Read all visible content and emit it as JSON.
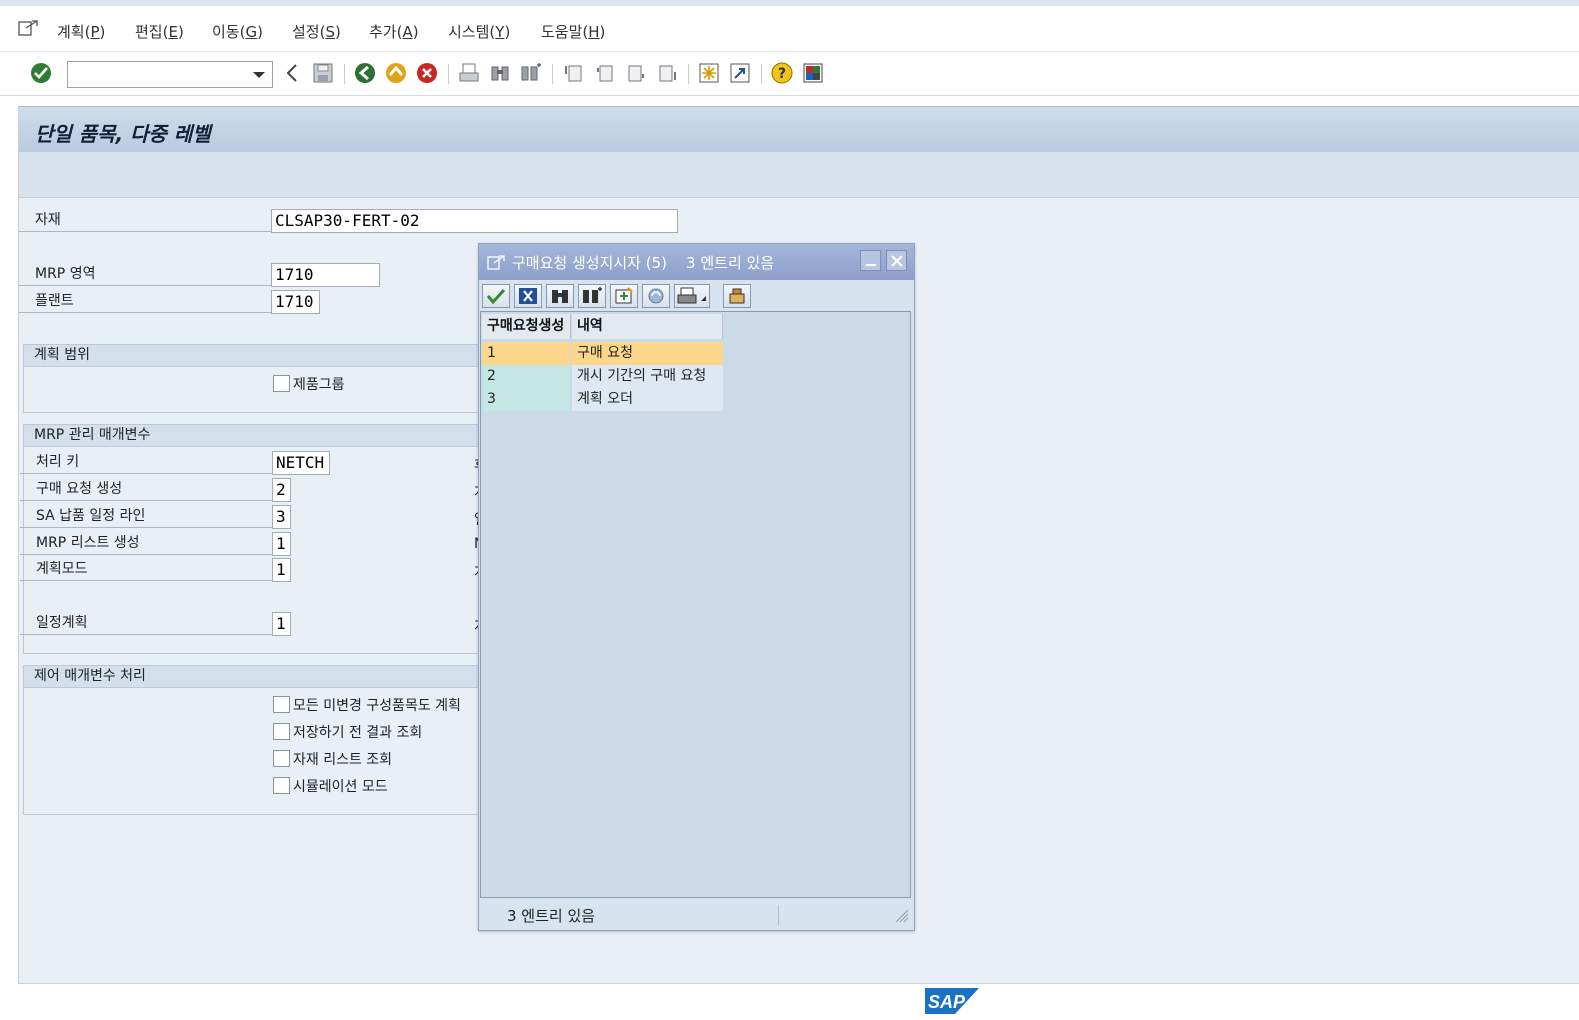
{
  "menubar": {
    "items": [
      {
        "text": "계획(",
        "key": "P",
        "end": ")"
      },
      {
        "text": "편집(",
        "key": "E",
        "end": ")"
      },
      {
        "text": "이동(",
        "key": "G",
        "end": ")"
      },
      {
        "text": "설정(",
        "key": "S",
        "end": ")"
      },
      {
        "text": "추가(",
        "key": "A",
        "end": ")"
      },
      {
        "text": "시스템(",
        "key": "Y",
        "end": ")"
      },
      {
        "text": "도움말(",
        "key": "H",
        "end": ")"
      }
    ]
  },
  "toolbar": {
    "command_field_value": ""
  },
  "screen": {
    "title": "단일 품목, 다중 레벨"
  },
  "fields": {
    "material_label": "자재",
    "material_value": "CLSAP30-FERT-02",
    "mrp_area_label": "MRP 영역",
    "mrp_area_value": "1710",
    "plant_label": "플랜트",
    "plant_value": "1710"
  },
  "groups": {
    "planning_scope": {
      "title": "계획 범위",
      "product_group_label": "제품그룹"
    },
    "mrp_control": {
      "title": "MRP 관리 매개변수",
      "processing_key_label": "처리 키",
      "processing_key_value": "NETCH",
      "create_pur_req_label": "구매 요청 생성",
      "create_pur_req_value": "2",
      "sa_deliv_sched_label": "SA 납품 일정 라인",
      "sa_deliv_sched_value": "3",
      "create_mrp_list_label": "MRP 리스트 생성",
      "create_mrp_list_value": "1",
      "planning_mode_label": "계획모드",
      "planning_mode_value": "1",
      "scheduling_label": "일정계획",
      "scheduling_value": "1",
      "clipped_right": [
        "후",
        "계",
        "일",
        "N",
        "계",
        "계"
      ]
    },
    "control_processing": {
      "title": "제어 매개변수 처리",
      "opt1": "모든 미변경 구성품목도 계획",
      "opt2": "저장하기 전 결과 조회",
      "opt3": "자재 리스트 조회",
      "opt4": "시뮬레이션 모드"
    }
  },
  "popup": {
    "title": "구매요청 생성지시자 (5)    3 엔트리 있음",
    "col1": "구매요청생성",
    "col2": "내역",
    "rows": [
      {
        "key": "1",
        "desc": "구매 요청"
      },
      {
        "key": "2",
        "desc": "개시 기간의 구매 요청"
      },
      {
        "key": "3",
        "desc": "계획 오더"
      }
    ],
    "status": "3 엔트리 있음"
  },
  "footer": {
    "logo_text": "SAP"
  },
  "colors": {
    "selected_row": "#fcd68a",
    "key_cell": "#c4e6e5",
    "desc_cell": "#dde8f2",
    "title_gradient_top": "#a5b6d9"
  }
}
